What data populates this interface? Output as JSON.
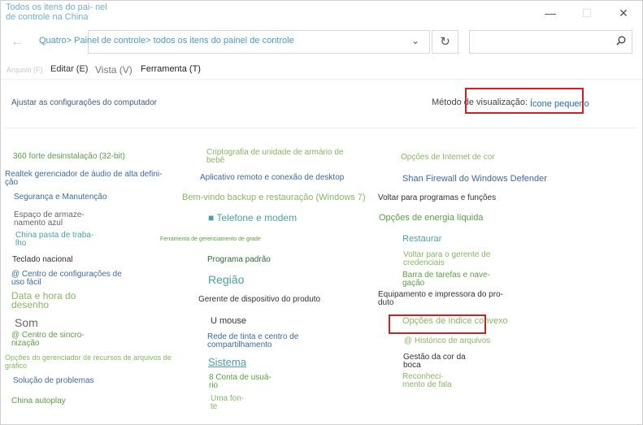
{
  "window": {
    "title": "Todos os itens do pai- nel de controle na China",
    "minimize_glyph": "—",
    "maximize_glyph": "☐",
    "close_glyph": "✕"
  },
  "nav": {
    "back_glyph": "←",
    "forward_glyph": "→",
    "address": "Quatro> Painel de controle> todos os itens do painel de controle",
    "dropdown_glyph": "⌄",
    "refresh_glyph": "↻",
    "search_placeholder": ""
  },
  "menu": {
    "arquivo": "Arquivo (F)",
    "editar": "Editar (E)",
    "vista": "Vista (V)",
    "ferramenta": "Ferramenta (T)"
  },
  "header": {
    "title": "Ajustar as configurações do computador",
    "view_label": "Método de visualização:",
    "view_value": "Ícone pequeno"
  },
  "items": {
    "c1": [
      "360 forte desinstalação (32-bit)",
      "Realtek gerenciador de áudio de alta defini- ção",
      "Segurança e Manutenção",
      "Espaço de armaze- namento azul",
      "China pasta de traba- lho",
      "Teclado nacional",
      "@ Centro de configurações de uso fácil",
      "Data e hora do desenho",
      "Som",
      "@ Centro de sincro- nização",
      "Opções do gerenciador de recursos de arquivos de gráfico",
      "Solução de problemas",
      "China autoplay"
    ],
    "c2": [
      "Criptografia de unidade de armário de bebê",
      "Aplicativo remoto e conexão de desktop",
      "Bem-vindo backup e restauração (Windows 7)",
      "■ Telefone e modem",
      "Ferramenta de gerenciamento de grade",
      "Programa padrão",
      "Região",
      "Gerente de dispositivo do produto",
      "U mouse",
      "Rede de tinta e centro de compartilhamento",
      "Sistema",
      "8 Conta de usuá- rio",
      "Uma fon- te"
    ],
    "c3": [
      "Opções de Internet de cor",
      "Shan Firewall do Windows Defender",
      "Voltar para programas e funções",
      "Opções de energia líquida",
      "Restaurar",
      "Voltar para o gerente de credenciais",
      "Barra de tarefas e nave- gação",
      "Equipamento e impressora do pro- duto",
      "Opções de índice convexo",
      "@ Histórico de arquivos",
      "Gestão da cor da boca",
      "Reconheci- mento de fala"
    ]
  }
}
